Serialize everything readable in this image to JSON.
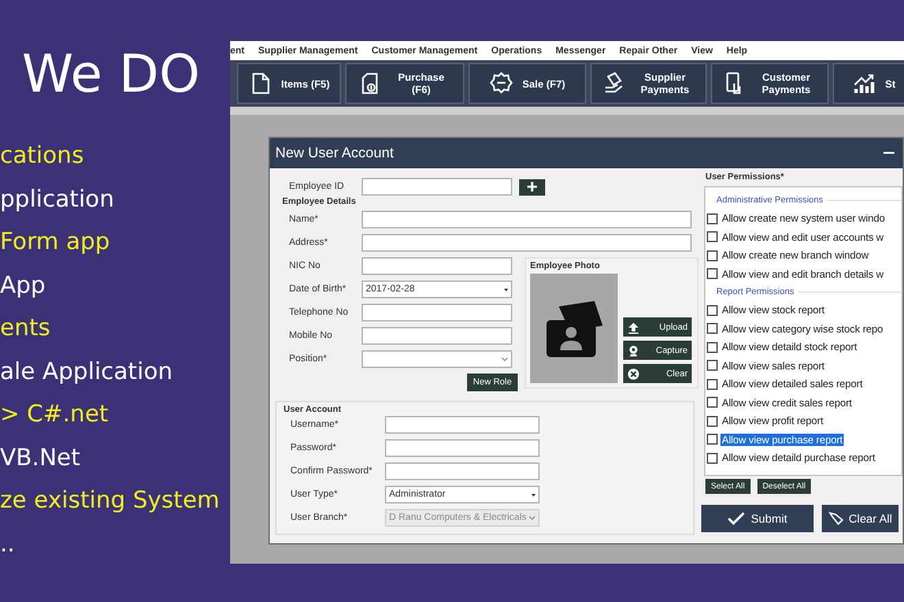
{
  "promo": {
    "heading": "We DO",
    "lines": [
      {
        "text": "cations",
        "color": "#f2ee1c"
      },
      {
        "text": "pplication",
        "color": "#ffffff"
      },
      {
        "text": "Form app",
        "color": "#f2ee1c"
      },
      {
        "text": "App",
        "color": "#ffffff"
      },
      {
        "text": "ents",
        "color": "#f2ee1c"
      },
      {
        "text": "ale Application",
        "color": "#ffffff"
      },
      {
        "text": "> C#.net",
        "color": "#f2ee1c"
      },
      {
        "text": "VB.Net",
        "color": "#ffffff"
      },
      {
        "text": "ze existing System",
        "color": "#f2ee1c"
      },
      {
        "text": "..",
        "color": "#ffffff"
      }
    ]
  },
  "menu_bar": [
    "ent",
    "Supplier Management",
    "Customer Management",
    "Operations",
    "Messenger",
    "Repair Other",
    "View",
    "Help"
  ],
  "toolbar": [
    {
      "kind": "document",
      "label": "Items (F5)"
    },
    {
      "kind": "purchase",
      "label": "Purchase (F6)"
    },
    {
      "kind": "sale",
      "label": "Sale (F7)"
    },
    {
      "kind": "supplier",
      "label": "Supplier Payments"
    },
    {
      "kind": "customer",
      "label": "Customer Payments"
    },
    {
      "kind": "chart",
      "label": "St"
    }
  ],
  "dialog": {
    "title": "New User Account",
    "employee_id": {
      "label": "Employee ID"
    },
    "details_heading": "Employee Details",
    "wide_fields": [
      {
        "label": "Name*",
        "kind": "text"
      },
      {
        "label": "Address*",
        "kind": "text"
      }
    ],
    "fields": [
      {
        "label": "NIC No",
        "kind": "text"
      },
      {
        "label": "Date of Birth*",
        "kind": "date",
        "value": "2017-02-28"
      },
      {
        "label": "Telephone No",
        "kind": "text"
      },
      {
        "label": "Mobile No",
        "kind": "text"
      },
      {
        "label": "Position*",
        "kind": "combo"
      }
    ],
    "new_role_button": "New Role",
    "photo": {
      "title": "Employee Photo",
      "buttons": [
        {
          "kind": "upload",
          "label": "Upload"
        },
        {
          "kind": "capture",
          "label": "Capture"
        },
        {
          "kind": "clear",
          "label": "Clear"
        }
      ]
    },
    "user_account": {
      "title": "User Account",
      "fields": [
        {
          "label": "Username*",
          "kind": "text",
          "disabled": false
        },
        {
          "label": "Password*",
          "kind": "text",
          "disabled": false
        },
        {
          "label": "Confirm Password*",
          "kind": "text",
          "disabled": false
        },
        {
          "label": "User Type*",
          "kind": "date",
          "value": "Administrator",
          "disabled": false
        },
        {
          "label": "User Branch*",
          "kind": "combo",
          "value": "D Ranu Computers & Electricals",
          "disabled": true
        }
      ]
    },
    "permissions": {
      "title": "User Permissions*",
      "groups": [
        {
          "title": "Administrative Permissions",
          "items": [
            {
              "label": "Allow create new system user windo",
              "checked": false,
              "selected": false
            },
            {
              "label": "Allow view and edit user accounts w",
              "checked": false,
              "selected": false
            },
            {
              "label": "Allow create new branch window",
              "checked": false,
              "selected": false
            },
            {
              "label": "Allow view and edit branch details w",
              "checked": false,
              "selected": false
            }
          ]
        },
        {
          "title": "Report Permissions",
          "items": [
            {
              "label": "Allow view stock report",
              "checked": false,
              "selected": false
            },
            {
              "label": "Allow view category wise stock repo",
              "checked": false,
              "selected": false
            },
            {
              "label": "Allow view detaild stock report",
              "checked": false,
              "selected": false
            },
            {
              "label": "Allow view sales report",
              "checked": false,
              "selected": false
            },
            {
              "label": "Allow view detailed sales report",
              "checked": false,
              "selected": false
            },
            {
              "label": "Allow view credit sales report",
              "checked": false,
              "selected": false
            },
            {
              "label": "Allow view profit report",
              "checked": false,
              "selected": false
            },
            {
              "label": "Allow view purchase report",
              "checked": false,
              "selected": true
            },
            {
              "label": "Allow view detaild purchase report",
              "checked": false,
              "selected": false
            }
          ]
        }
      ],
      "list_buttons": [
        "Select All",
        "Deselect All"
      ]
    },
    "actions": [
      {
        "kind": "submit",
        "label": "Submit"
      },
      {
        "kind": "clear",
        "label": "Clear All"
      }
    ]
  }
}
